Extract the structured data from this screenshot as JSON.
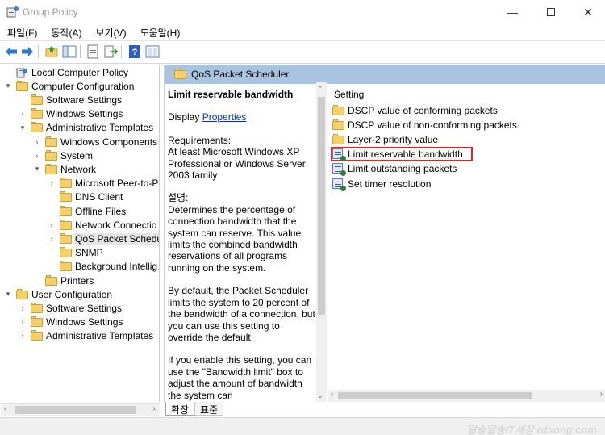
{
  "window": {
    "title": "Group Policy",
    "controls": [
      "minimize-icon",
      "maximize-icon",
      "close-icon"
    ]
  },
  "menu": [
    "파일(F)",
    "동작(A)",
    "보기(V)",
    "도움말(H)"
  ],
  "toolbar": {
    "icons": [
      "back-arrow-icon",
      "forward-arrow-icon",
      "up-folder-icon",
      "show-hide-tree-icon",
      "properties-icon",
      "export-list-icon",
      "help-icon",
      "view-icon"
    ]
  },
  "tree": {
    "nodes": [
      {
        "label": "Local Computer Policy",
        "level": 0,
        "expander": "",
        "icon": "computer-policy-icon"
      },
      {
        "label": "Computer Configuration",
        "level": 0,
        "expander": "▾",
        "icon": "folder-icon"
      },
      {
        "label": "Software Settings",
        "level": 1,
        "expander": "",
        "icon": "folder-icon"
      },
      {
        "label": "Windows Settings",
        "level": 1,
        "expander": "›",
        "icon": "folder-icon"
      },
      {
        "label": "Administrative Templates",
        "level": 1,
        "expander": "▾",
        "icon": "folder-icon"
      },
      {
        "label": "Windows Components",
        "level": 2,
        "expander": "›",
        "icon": "folder-icon"
      },
      {
        "label": "System",
        "level": 2,
        "expander": "›",
        "icon": "folder-icon"
      },
      {
        "label": "Network",
        "level": 2,
        "expander": "▾",
        "icon": "folder-icon"
      },
      {
        "label": "Microsoft Peer-to-P",
        "level": 3,
        "expander": "›",
        "icon": "folder-icon"
      },
      {
        "label": "DNS Client",
        "level": 3,
        "expander": "",
        "icon": "folder-icon"
      },
      {
        "label": "Offline Files",
        "level": 3,
        "expander": "",
        "icon": "folder-icon"
      },
      {
        "label": "Network Connectio",
        "level": 3,
        "expander": "›",
        "icon": "folder-icon"
      },
      {
        "label": "QoS Packet Schedu",
        "level": 3,
        "expander": "›",
        "icon": "folder-icon",
        "selected": true
      },
      {
        "label": "SNMP",
        "level": 3,
        "expander": "",
        "icon": "folder-icon"
      },
      {
        "label": "Background Intellig",
        "level": 3,
        "expander": "",
        "icon": "folder-icon"
      },
      {
        "label": "Printers",
        "level": 2,
        "expander": "",
        "icon": "folder-icon"
      },
      {
        "label": "User Configuration",
        "level": 0,
        "expander": "▾",
        "icon": "folder-icon"
      },
      {
        "label": "Software Settings",
        "level": 1,
        "expander": "›",
        "icon": "folder-icon"
      },
      {
        "label": "Windows Settings",
        "level": 1,
        "expander": "›",
        "icon": "folder-icon"
      },
      {
        "label": "Administrative Templates",
        "level": 1,
        "expander": "›",
        "icon": "folder-icon"
      }
    ]
  },
  "right_header": "QoS Packet Scheduler",
  "description": {
    "title": "Limit reservable bandwidth",
    "display_prefix": "Display ",
    "display_link": "Properties ",
    "requirements_label": "Requirements:",
    "requirements": "At least Microsoft Windows XP Professional or Windows Server 2003 family",
    "explain_label": "설명:",
    "explain_1": "Determines the percentage of connection bandwidth that the system can reserve. This value limits the combined bandwidth reservations of all programs running on the system.",
    "explain_2": "By default, the Packet Scheduler limits the system to 20 percent of the bandwidth of a connection, but you can use this setting to override the default.",
    "explain_3": "If you enable this setting, you can use the \"Bandwidth limit\" box to adjust the amount of bandwidth the system can"
  },
  "list": {
    "column_header": "Setting",
    "rows": [
      {
        "label": "DSCP value of conforming packets",
        "icon": "folder-icon"
      },
      {
        "label": "DSCP value of non-conforming packets",
        "icon": "folder-icon"
      },
      {
        "label": "Layer-2 priority value",
        "icon": "folder-icon"
      },
      {
        "label": "Limit reservable bandwidth",
        "icon": "policy-setting-icon",
        "highlighted": true
      },
      {
        "label": "Limit outstanding packets",
        "icon": "policy-setting-icon"
      },
      {
        "label": "Set timer resolution",
        "icon": "policy-setting-icon"
      }
    ]
  },
  "tabs": [
    "확장",
    "표준"
  ],
  "watermark": "알송달송IT세상 rdsong.com"
}
